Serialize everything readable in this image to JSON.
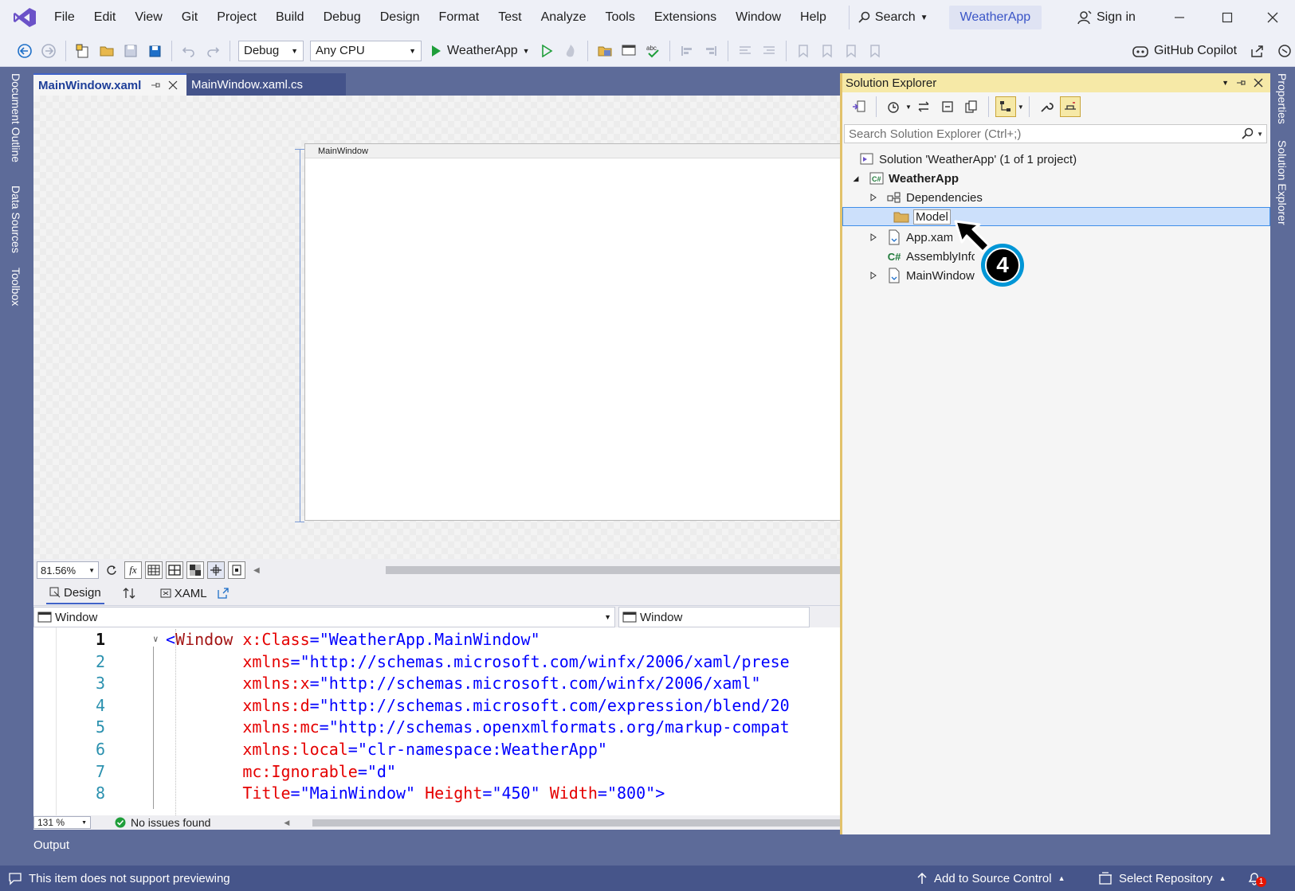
{
  "menu": {
    "items": [
      "File",
      "Edit",
      "View",
      "Git",
      "Project",
      "Build",
      "Debug",
      "Design",
      "Format",
      "Test",
      "Analyze",
      "Tools",
      "Extensions",
      "Window",
      "Help"
    ],
    "search_label": "Search",
    "solution_name": "WeatherApp",
    "sign_in": "Sign in"
  },
  "toolbar": {
    "config": "Debug",
    "platform": "Any CPU",
    "run_target": "WeatherApp",
    "copilot": "GitHub Copilot"
  },
  "side_tabs": [
    "Document Outline",
    "Data Sources",
    "Toolbox"
  ],
  "right_tabs": [
    "Properties",
    "Solution Explorer"
  ],
  "doc_tabs": [
    {
      "label": "MainWindow.xaml",
      "active": true
    },
    {
      "label": "MainWindow.xaml.cs",
      "active": false
    }
  ],
  "designer": {
    "window_title": "MainWindow",
    "zoom": "81.56%"
  },
  "split": {
    "design_label": "Design",
    "xaml_label": "XAML"
  },
  "nav": {
    "left": "Window",
    "right": "Window"
  },
  "code": {
    "lines": [
      {
        "n": "1",
        "parts": [
          [
            "punc",
            "<"
          ],
          [
            "tag",
            "Window"
          ],
          [
            "plain",
            " "
          ],
          [
            "attr",
            "x:Class"
          ],
          [
            "punc",
            "="
          ],
          [
            "val",
            "\"WeatherApp.MainWindow\""
          ]
        ]
      },
      {
        "n": "2",
        "parts": [
          [
            "attr",
            "        xmlns"
          ],
          [
            "punc",
            "="
          ],
          [
            "val",
            "\"http://schemas.microsoft.com/winfx/2006/xaml/prese"
          ]
        ]
      },
      {
        "n": "3",
        "parts": [
          [
            "attr",
            "        xmlns:x"
          ],
          [
            "punc",
            "="
          ],
          [
            "val",
            "\"http://schemas.microsoft.com/winfx/2006/xaml\""
          ]
        ]
      },
      {
        "n": "4",
        "parts": [
          [
            "attr",
            "        xmlns:d"
          ],
          [
            "punc",
            "="
          ],
          [
            "val",
            "\"http://schemas.microsoft.com/expression/blend/20"
          ]
        ]
      },
      {
        "n": "5",
        "parts": [
          [
            "attr",
            "        xmlns:mc"
          ],
          [
            "punc",
            "="
          ],
          [
            "val",
            "\"http://schemas.openxmlformats.org/markup-compat"
          ]
        ]
      },
      {
        "n": "6",
        "parts": [
          [
            "attr",
            "        xmlns:local"
          ],
          [
            "punc",
            "="
          ],
          [
            "val",
            "\"clr-namespace:WeatherApp\""
          ]
        ]
      },
      {
        "n": "7",
        "parts": [
          [
            "attr",
            "        mc:Ignorable"
          ],
          [
            "punc",
            "="
          ],
          [
            "val",
            "\"d\""
          ]
        ]
      },
      {
        "n": "8",
        "parts": [
          [
            "attr",
            "        Title"
          ],
          [
            "punc",
            "="
          ],
          [
            "val",
            "\"MainWindow\""
          ],
          [
            "plain",
            " "
          ],
          [
            "attr",
            "Height"
          ],
          [
            "punc",
            "="
          ],
          [
            "val",
            "\"450\""
          ],
          [
            "plain",
            " "
          ],
          [
            "attr",
            "Width"
          ],
          [
            "punc",
            "="
          ],
          [
            "val",
            "\"800\""
          ],
          [
            "punc",
            ">"
          ]
        ]
      }
    ],
    "zoom": "131 %",
    "issues": "No issues found"
  },
  "output_tab": "Output",
  "solution_explorer": {
    "title": "Solution Explorer",
    "search_placeholder": "Search Solution Explorer (Ctrl+;)",
    "tree": [
      {
        "label": "Solution 'WeatherApp' (1 of 1 project)",
        "icon": "solution-icon"
      },
      {
        "label": "WeatherApp",
        "icon": "csharp-project-icon"
      },
      {
        "label": "Dependencies",
        "icon": "dependencies-icon"
      },
      {
        "label": "Model",
        "icon": "folder-icon"
      },
      {
        "label": "App.xaml",
        "icon": "xaml-file-icon"
      },
      {
        "label": "AssemblyInfo.cs",
        "icon": "csharp-file-icon"
      },
      {
        "label": "MainWindow.xaml",
        "icon": "xaml-file-icon"
      }
    ],
    "step_badge": "4"
  },
  "status": {
    "message": "This item does not support previewing",
    "source_control": "Add to Source Control",
    "repository": "Select Repository",
    "notifications": "1"
  },
  "colors": {
    "accent": "#3f8ee8",
    "step_badge": "#0096d6",
    "chrome": "#5d6b99",
    "statusbar": "#46558a"
  }
}
